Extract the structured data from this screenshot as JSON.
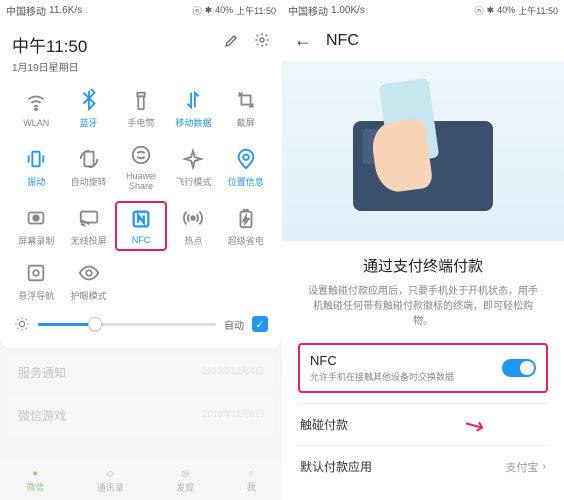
{
  "status": {
    "carrier": "中国移动",
    "net_label_left": "11.6K/s",
    "net_label_right": "1.00K/s",
    "battery": "40%",
    "time": "上午11:50"
  },
  "qs": {
    "time": "中午11:50",
    "date": "1月19日星期日",
    "tiles": [
      {
        "label": "WLAN",
        "active": false,
        "icon": "wifi-icon"
      },
      {
        "label": "蓝牙",
        "active": true,
        "icon": "bluetooth-icon"
      },
      {
        "label": "手电筒",
        "active": false,
        "icon": "flashlight-icon"
      },
      {
        "label": "移动数据",
        "active": true,
        "icon": "data-icon"
      },
      {
        "label": "截屏",
        "active": false,
        "icon": "screenshot-icon"
      },
      {
        "label": "振动",
        "active": true,
        "icon": "vibrate-icon"
      },
      {
        "label": "自动旋转",
        "active": false,
        "icon": "rotate-icon"
      },
      {
        "label": "Huawei Share",
        "active": false,
        "icon": "share-icon"
      },
      {
        "label": "飞行模式",
        "active": false,
        "icon": "airplane-icon"
      },
      {
        "label": "位置信息",
        "active": true,
        "icon": "location-icon"
      },
      {
        "label": "屏幕录制",
        "active": false,
        "icon": "record-icon"
      },
      {
        "label": "无线投屏",
        "active": false,
        "icon": "cast-icon"
      },
      {
        "label": "NFC",
        "active": true,
        "icon": "nfc-icon",
        "highlighted": true
      },
      {
        "label": "热点",
        "active": false,
        "icon": "hotspot-icon"
      },
      {
        "label": "超级省电",
        "active": false,
        "icon": "battery-saver-icon"
      },
      {
        "label": "悬浮导航",
        "active": false,
        "icon": "float-nav-icon"
      },
      {
        "label": "护眼模式",
        "active": false,
        "icon": "eye-icon"
      }
    ],
    "brightness_auto": "自动"
  },
  "bg": {
    "items": [
      {
        "title": "服务通知",
        "sub": "",
        "date": "2019年12月4日"
      },
      {
        "title": "微信游戏",
        "sub": "",
        "date": "2019年11月8日"
      }
    ],
    "nav": [
      "微信",
      "通讯录",
      "发现",
      "我"
    ]
  },
  "nfc": {
    "title": "NFC",
    "heading": "通过支付终端付款",
    "desc": "设置触碰付款应用后，只要手机处于开机状态，用手机触碰任何带有触碰付款徽标的终端，即可轻松购物。",
    "toggle_title": "NFC",
    "toggle_sub": "允许手机在接触其他设备时交换数据",
    "row1": "触碰付款",
    "row2_label": "默认付款应用",
    "row2_value": "支付宝"
  }
}
